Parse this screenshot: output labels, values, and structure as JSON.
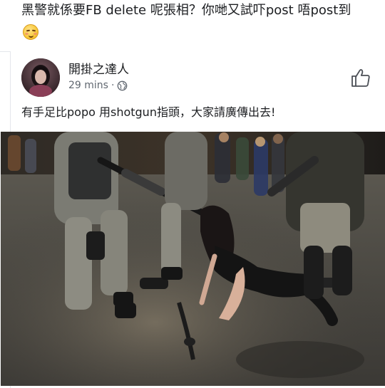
{
  "previous_comment": {
    "text": "黑警就係要FB delete 呢張相？你哋又試吓post 唔post到",
    "emoji": "blushing-face-emoji"
  },
  "post": {
    "author": "開掛之達人",
    "time": "29 mins",
    "separator": "·",
    "audience_icon": "globe-icon",
    "like_icon": "thumbs-up-icon",
    "caption": "有手足比popo 用shotgun指頭，大家請廣傳出去!",
    "photo_icon": "news-photo"
  },
  "colors": {
    "text": "#1c1e21",
    "meta": "#606770",
    "like_icon": "#4b4f56",
    "divider": "#e4e6eb"
  }
}
